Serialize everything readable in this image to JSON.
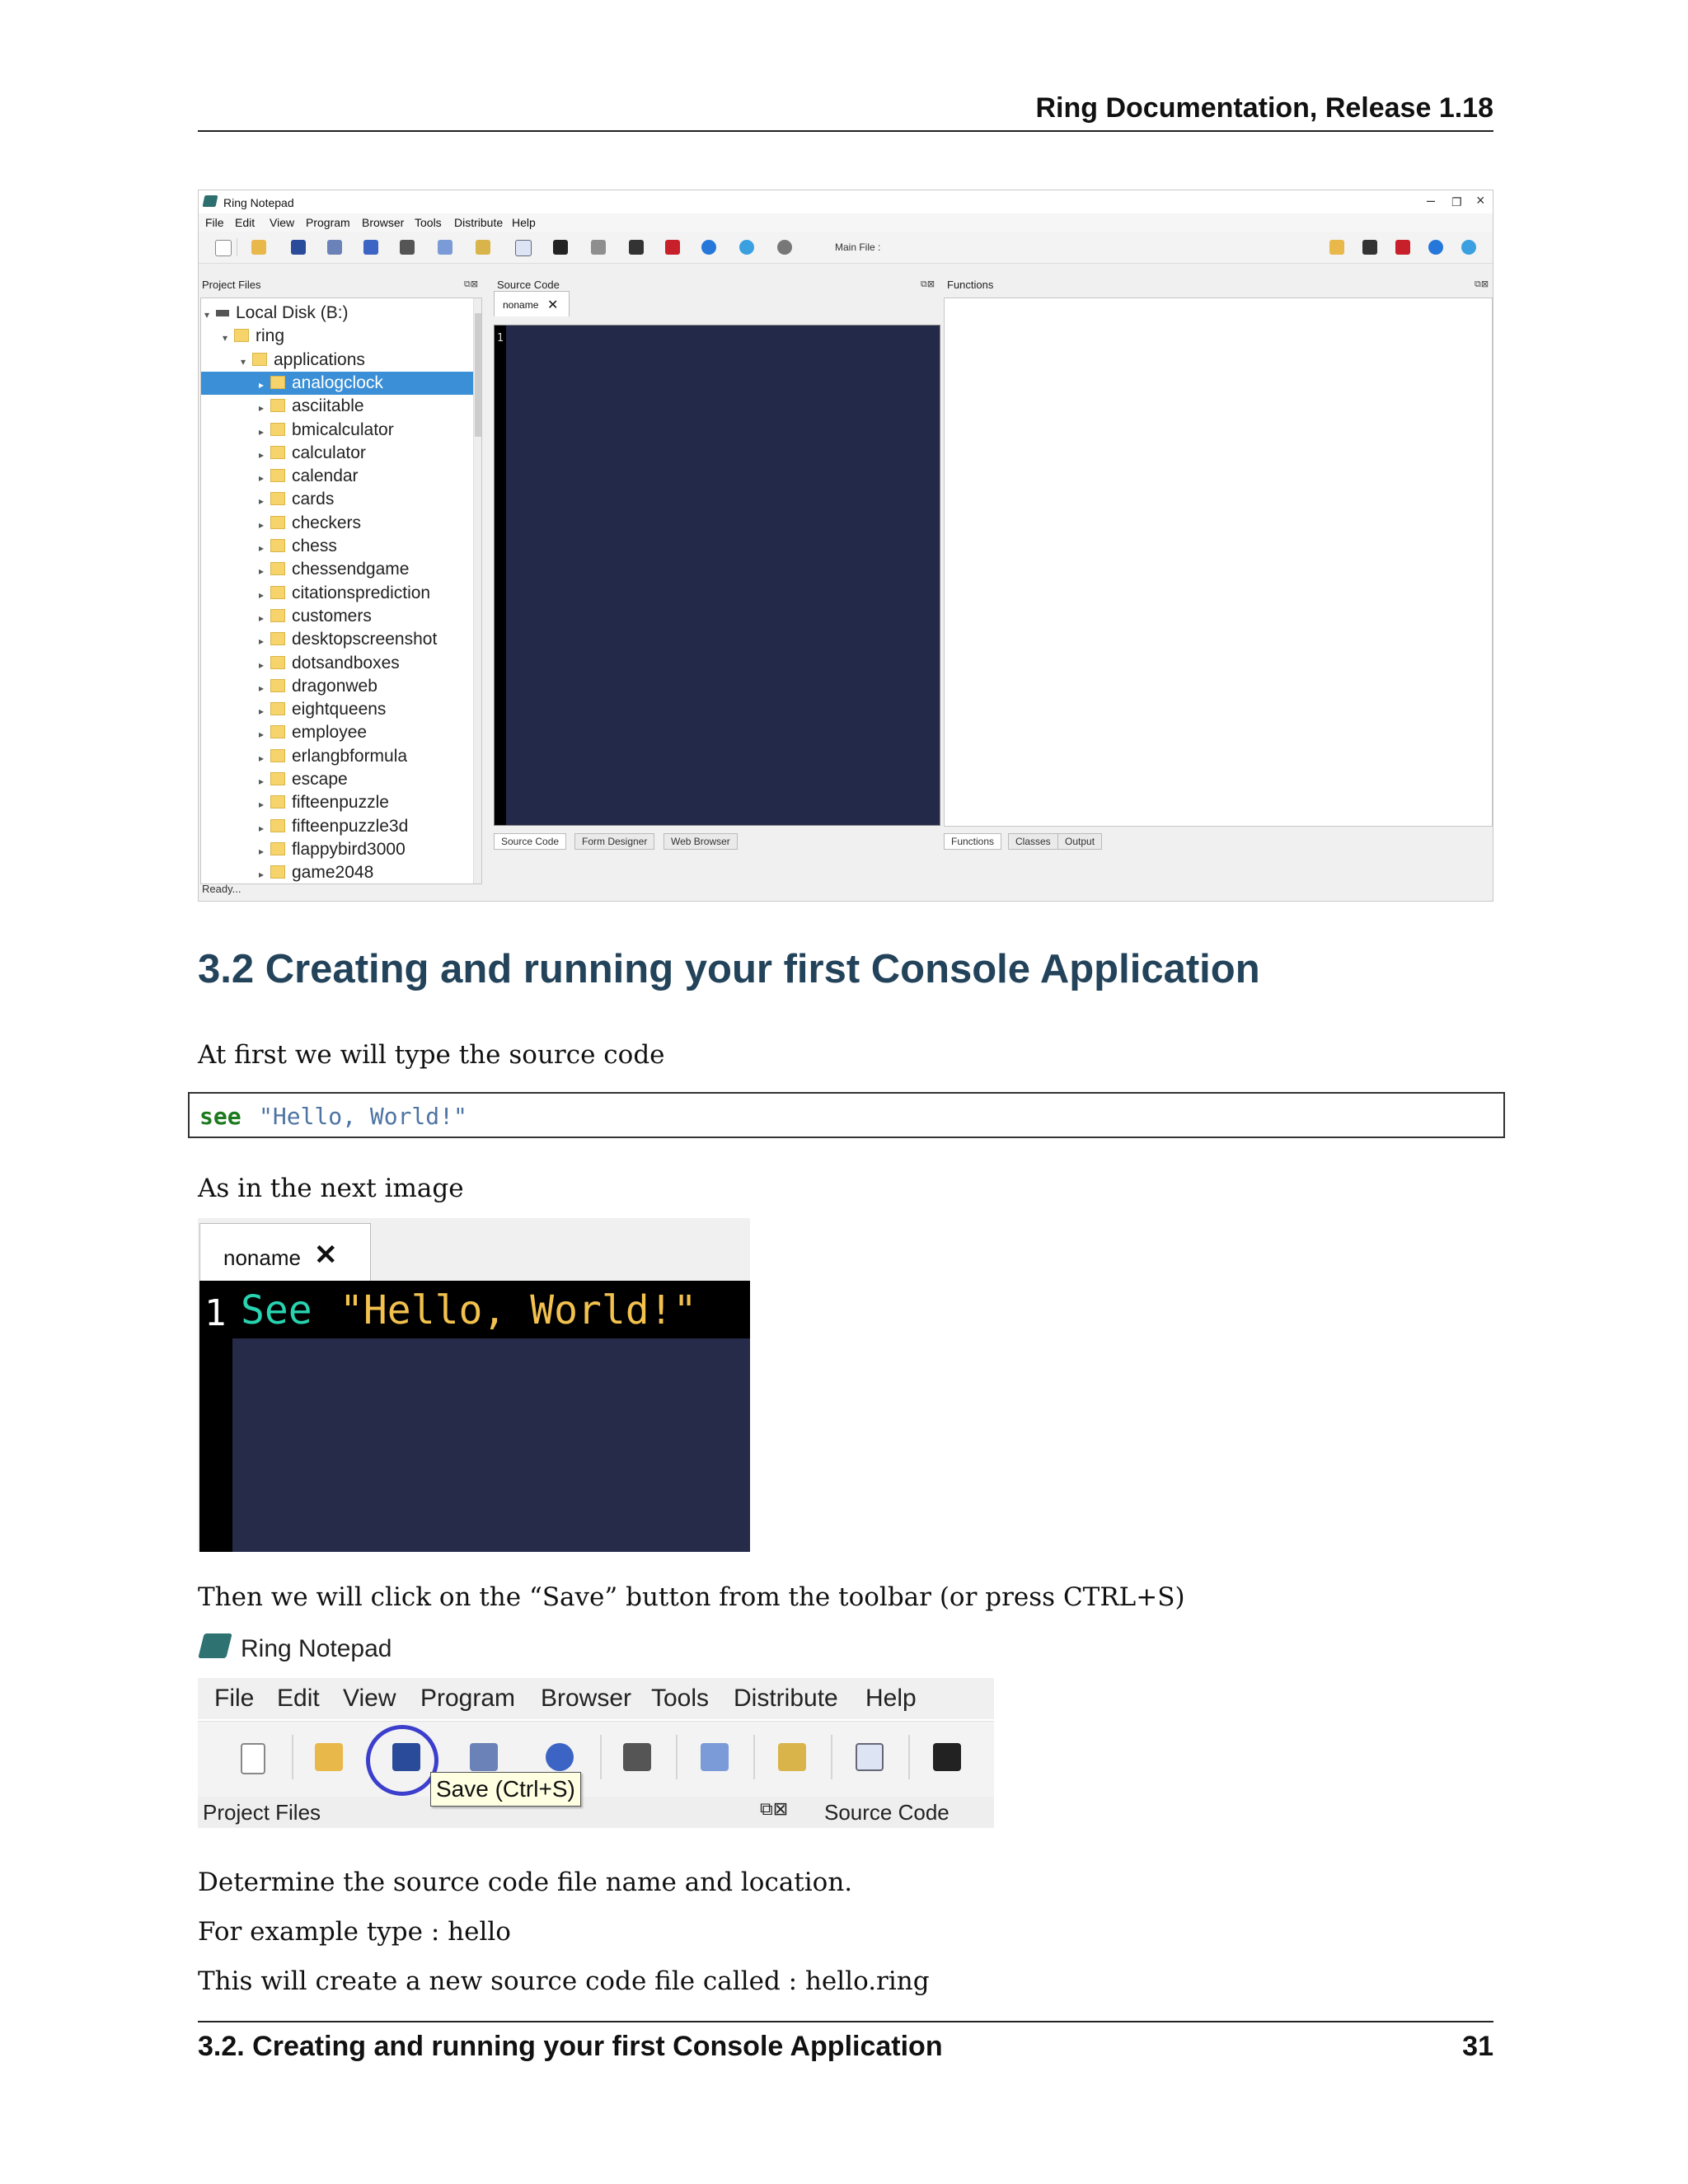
{
  "header": {
    "title": "Ring Documentation, Release 1.18"
  },
  "notepad_window": {
    "title": "Ring Notepad",
    "menus": [
      "File",
      "Edit",
      "View",
      "Program",
      "Browser",
      "Tools",
      "Distribute",
      "Help"
    ],
    "main_file_label": "Main File :",
    "project_files_header": "Project Files",
    "source_code_header": "Source Code",
    "functions_header": "Functions",
    "editor_tab": "noname",
    "line_number": "1",
    "tree": [
      {
        "label": "Local Disk (B:)",
        "level": 0,
        "type": "drive"
      },
      {
        "label": "ring",
        "level": 1,
        "type": "folder"
      },
      {
        "label": "applications",
        "level": 2,
        "type": "folder"
      },
      {
        "label": "analogclock",
        "level": 3,
        "type": "folder",
        "selected": true
      },
      {
        "label": "asciitable",
        "level": 3,
        "type": "folder"
      },
      {
        "label": "bmicalculator",
        "level": 3,
        "type": "folder"
      },
      {
        "label": "calculator",
        "level": 3,
        "type": "folder"
      },
      {
        "label": "calendar",
        "level": 3,
        "type": "folder"
      },
      {
        "label": "cards",
        "level": 3,
        "type": "folder"
      },
      {
        "label": "checkers",
        "level": 3,
        "type": "folder"
      },
      {
        "label": "chess",
        "level": 3,
        "type": "folder"
      },
      {
        "label": "chessendgame",
        "level": 3,
        "type": "folder"
      },
      {
        "label": "citationsprediction",
        "level": 3,
        "type": "folder"
      },
      {
        "label": "customers",
        "level": 3,
        "type": "folder"
      },
      {
        "label": "desktopscreenshot",
        "level": 3,
        "type": "folder"
      },
      {
        "label": "dotsandboxes",
        "level": 3,
        "type": "folder"
      },
      {
        "label": "dragonweb",
        "level": 3,
        "type": "folder"
      },
      {
        "label": "eightqueens",
        "level": 3,
        "type": "folder"
      },
      {
        "label": "employee",
        "level": 3,
        "type": "folder"
      },
      {
        "label": "erlangbformula",
        "level": 3,
        "type": "folder"
      },
      {
        "label": "escape",
        "level": 3,
        "type": "folder"
      },
      {
        "label": "fifteenpuzzle",
        "level": 3,
        "type": "folder"
      },
      {
        "label": "fifteenpuzzle3d",
        "level": 3,
        "type": "folder"
      },
      {
        "label": "flappybird3000",
        "level": 3,
        "type": "folder"
      },
      {
        "label": "game2048",
        "level": 3,
        "type": "folder"
      }
    ],
    "bottom_tabs_center": [
      "Source Code",
      "Form Designer",
      "Web Browser"
    ],
    "bottom_tabs_right": [
      "Functions",
      "Classes",
      "Output"
    ],
    "status": "Ready..."
  },
  "section": {
    "heading": "3.2  Creating and running your first Console Application",
    "intro": "At first we will type the source code",
    "code_keyword": "see",
    "code_string": "\"Hello, World!\"",
    "after_code": "As in the next image",
    "after_image": "Then we will click on the “Save” button from the toolbar (or press CTRL+S)",
    "p1": "Determine the source code file name and location.",
    "p2": "For example type : hello",
    "p3": "This will create a new source code file called : hello.ring"
  },
  "editor_closeup": {
    "tab": "noname",
    "line_number": "1",
    "code_keyword": "See",
    "code_string": "\"Hello, World!\""
  },
  "toolbar_closeup": {
    "title": "Ring Notepad",
    "menus": [
      "File",
      "Edit",
      "View",
      "Program",
      "Browser",
      "Tools",
      "Distribute",
      "Help"
    ],
    "tooltip": "Save (Ctrl+S)",
    "project_files_label": "Project Files",
    "source_code_label": "Source Code"
  },
  "footer": {
    "section": "3.2.  Creating and running your first Console Application",
    "page_number": "31"
  },
  "colors": {
    "heading": "#23435a",
    "editor_bg": "#262b4a",
    "selection": "#3a8fd6",
    "code_keyword_doc": "#1e7a1e",
    "code_string_doc": "#4d74a3",
    "highlight_circle": "#3b3fcc"
  }
}
